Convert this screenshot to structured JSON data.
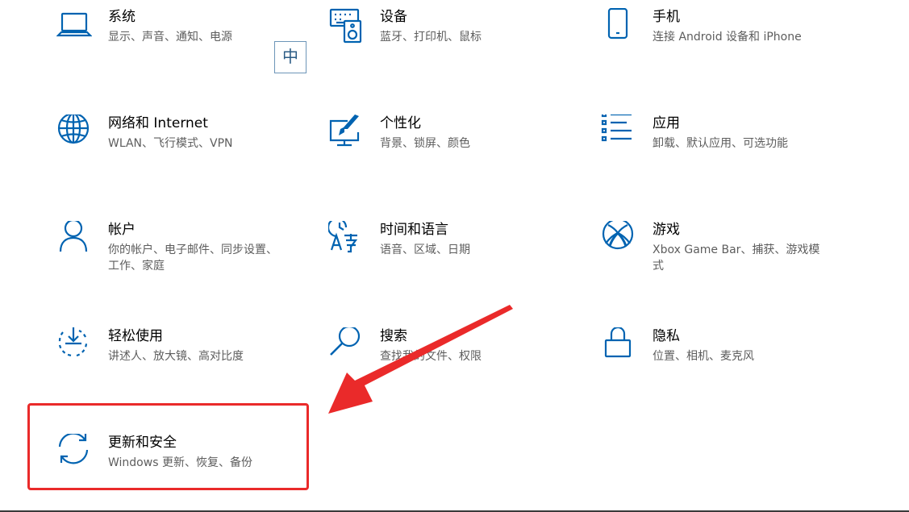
{
  "colors": {
    "icon_blue": "#0063b1",
    "annotation_red": "#ea2a2a",
    "title_text": "#000000",
    "desc_text": "#5d5d5d"
  },
  "ime_indicator": {
    "label": "中"
  },
  "tiles": [
    {
      "icon": "laptop-icon",
      "title": "系统",
      "desc": "显示、声音、通知、电源"
    },
    {
      "icon": "keyboard-speaker-icon",
      "title": "设备",
      "desc": "蓝牙、打印机、鼠标"
    },
    {
      "icon": "phone-icon",
      "title": "手机",
      "desc": "连接 Android 设备和 iPhone"
    },
    {
      "icon": "globe-icon",
      "title": "网络和 Internet",
      "desc": "WLAN、飞行模式、VPN"
    },
    {
      "icon": "paintbrush-monitor-icon",
      "title": "个性化",
      "desc": "背景、锁屏、颜色"
    },
    {
      "icon": "app-list-icon",
      "title": "应用",
      "desc": "卸载、默认应用、可选功能"
    },
    {
      "icon": "person-icon",
      "title": "帐户",
      "desc": "你的帐户、电子邮件、同步设置、工作、家庭"
    },
    {
      "icon": "time-language-icon",
      "title": "时间和语言",
      "desc": "语音、区域、日期"
    },
    {
      "icon": "xbox-icon",
      "title": "游戏",
      "desc": "Xbox Game Bar、捕获、游戏模式"
    },
    {
      "icon": "ease-of-access-icon",
      "title": "轻松使用",
      "desc": "讲述人、放大镜、高对比度"
    },
    {
      "icon": "search-icon",
      "title": "搜索",
      "desc": "查找我的文件、权限"
    },
    {
      "icon": "lock-icon",
      "title": "隐私",
      "desc": "位置、相机、麦克风"
    },
    {
      "icon": "sync-icon",
      "title": "更新和安全",
      "desc": "Windows 更新、恢复、备份"
    }
  ]
}
